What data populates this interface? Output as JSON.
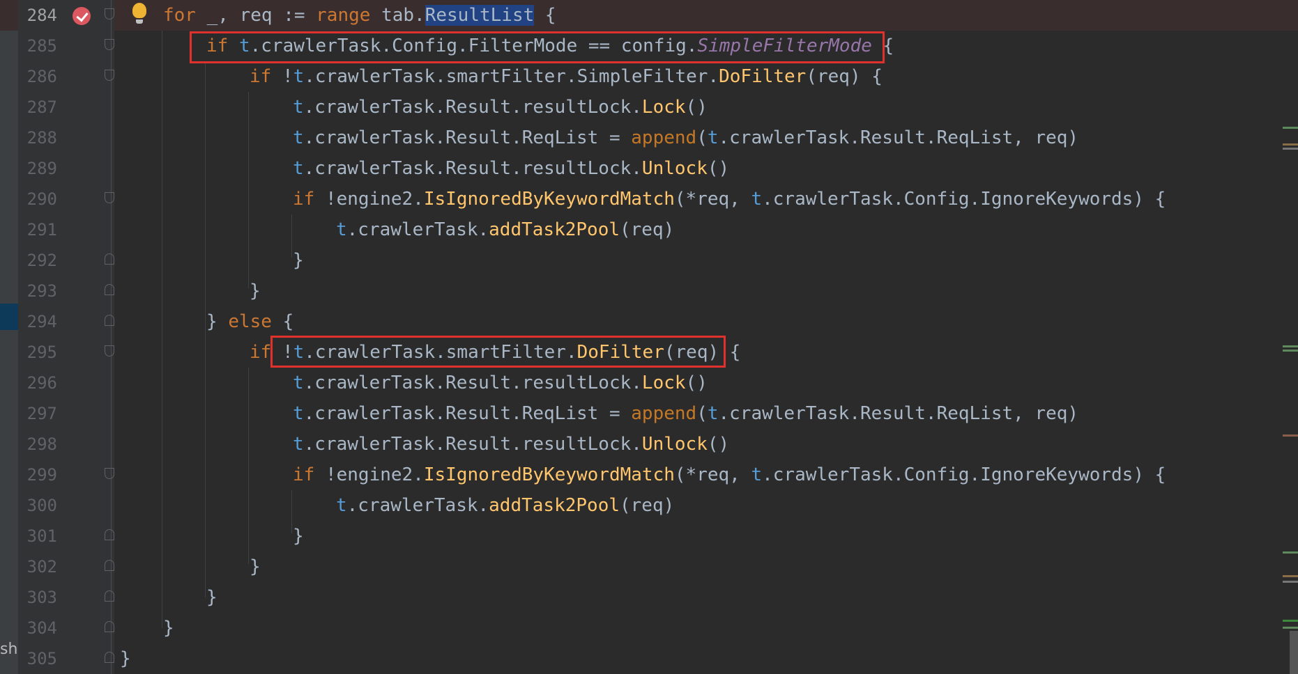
{
  "editor": {
    "partial_left_label": "sh",
    "highlighted_identifier": "ResultList",
    "lines": [
      {
        "num": "284"
      },
      {
        "num": "285"
      },
      {
        "num": "286"
      },
      {
        "num": "287"
      },
      {
        "num": "288"
      },
      {
        "num": "289"
      },
      {
        "num": "290"
      },
      {
        "num": "291"
      },
      {
        "num": "292"
      },
      {
        "num": "293"
      },
      {
        "num": "294"
      },
      {
        "num": "295"
      },
      {
        "num": "296"
      },
      {
        "num": "297"
      },
      {
        "num": "298"
      },
      {
        "num": "299"
      },
      {
        "num": "300"
      },
      {
        "num": "301"
      },
      {
        "num": "302"
      },
      {
        "num": "303"
      },
      {
        "num": "304"
      },
      {
        "num": "305"
      }
    ]
  },
  "code": {
    "l284": {
      "kw_for": "for",
      "rest1": " _, req := ",
      "kw_range": "range",
      "rest2": " tab.",
      "sel": "ResultList",
      "rest3": " {"
    },
    "l285": {
      "kw_if": "if",
      "t": "t",
      "mid": ".crawlerTask.Config.FilterMode == config.",
      "const": "SimpleFilterMode",
      "end": " {"
    },
    "l286": {
      "kw_if": "if",
      "not": " !",
      "t": "t",
      "mid": ".crawlerTask.smartFilter.SimpleFilter.",
      "fn": "DoFilter",
      "end": "(req) {"
    },
    "l287": {
      "t": "t",
      "mid": ".crawlerTask.Result.resultLock.",
      "fn": "Lock",
      "end": "()"
    },
    "l288": {
      "t": "t",
      "mid": ".crawlerTask.Result.ReqList = ",
      "builtin": "append",
      "p": "(",
      "t2": "t",
      "mid2": ".crawlerTask.Result.ReqList, req)"
    },
    "l289": {
      "t": "t",
      "mid": ".crawlerTask.Result.resultLock.",
      "fn": "Unlock",
      "end": "()"
    },
    "l290": {
      "kw_if": "if",
      "not": " !engine2.",
      "fn": "IsIgnoredByKeywordMatch",
      "mid": "(*req, ",
      "t": "t",
      "end": ".crawlerTask.Config.IgnoreKeywords) {"
    },
    "l291": {
      "t": "t",
      "mid": ".crawlerTask.",
      "fn": "addTask2Pool",
      "end": "(req)"
    },
    "l292": {
      "brace": "}"
    },
    "l293": {
      "brace": "}"
    },
    "l294": {
      "close": "} ",
      "kw_else": "else",
      "open": " {"
    },
    "l295": {
      "kw_if": "if",
      "not": " !",
      "t": "t",
      "mid": ".crawlerTask.smartFilter.",
      "fn": "DoFilter",
      "end": "(req) {"
    },
    "l296": {
      "t": "t",
      "mid": ".crawlerTask.Result.resultLock.",
      "fn": "Lock",
      "end": "()"
    },
    "l297": {
      "t": "t",
      "mid": ".crawlerTask.Result.ReqList = ",
      "builtin": "append",
      "p": "(",
      "t2": "t",
      "mid2": ".crawlerTask.Result.ReqList, req)"
    },
    "l298": {
      "t": "t",
      "mid": ".crawlerTask.Result.resultLock.",
      "fn": "Unlock",
      "end": "()"
    },
    "l299": {
      "kw_if": "if",
      "not": " !engine2.",
      "fn": "IsIgnoredByKeywordMatch",
      "mid": "(*req, ",
      "t": "t",
      "end": ".crawlerTask.Config.IgnoreKeywords) {"
    },
    "l300": {
      "t": "t",
      "mid": ".crawlerTask.",
      "fn": "addTask2Pool",
      "end": "(req)"
    },
    "l301": {
      "brace": "}"
    },
    "l302": {
      "brace": "}"
    },
    "l303": {
      "brace": "}"
    },
    "l304": {
      "brace": "}"
    },
    "l305": {
      "brace": "}"
    }
  },
  "icons": {
    "breakpoint": "breakpoint-check-icon",
    "intention": "lightbulb-icon"
  },
  "colors": {
    "keyword": "#cc7832",
    "function": "#ffc66d",
    "constant": "#9876aa",
    "receiver": "#569cd6",
    "annotation_box": "#e0312c",
    "background": "#2b2b2b"
  }
}
